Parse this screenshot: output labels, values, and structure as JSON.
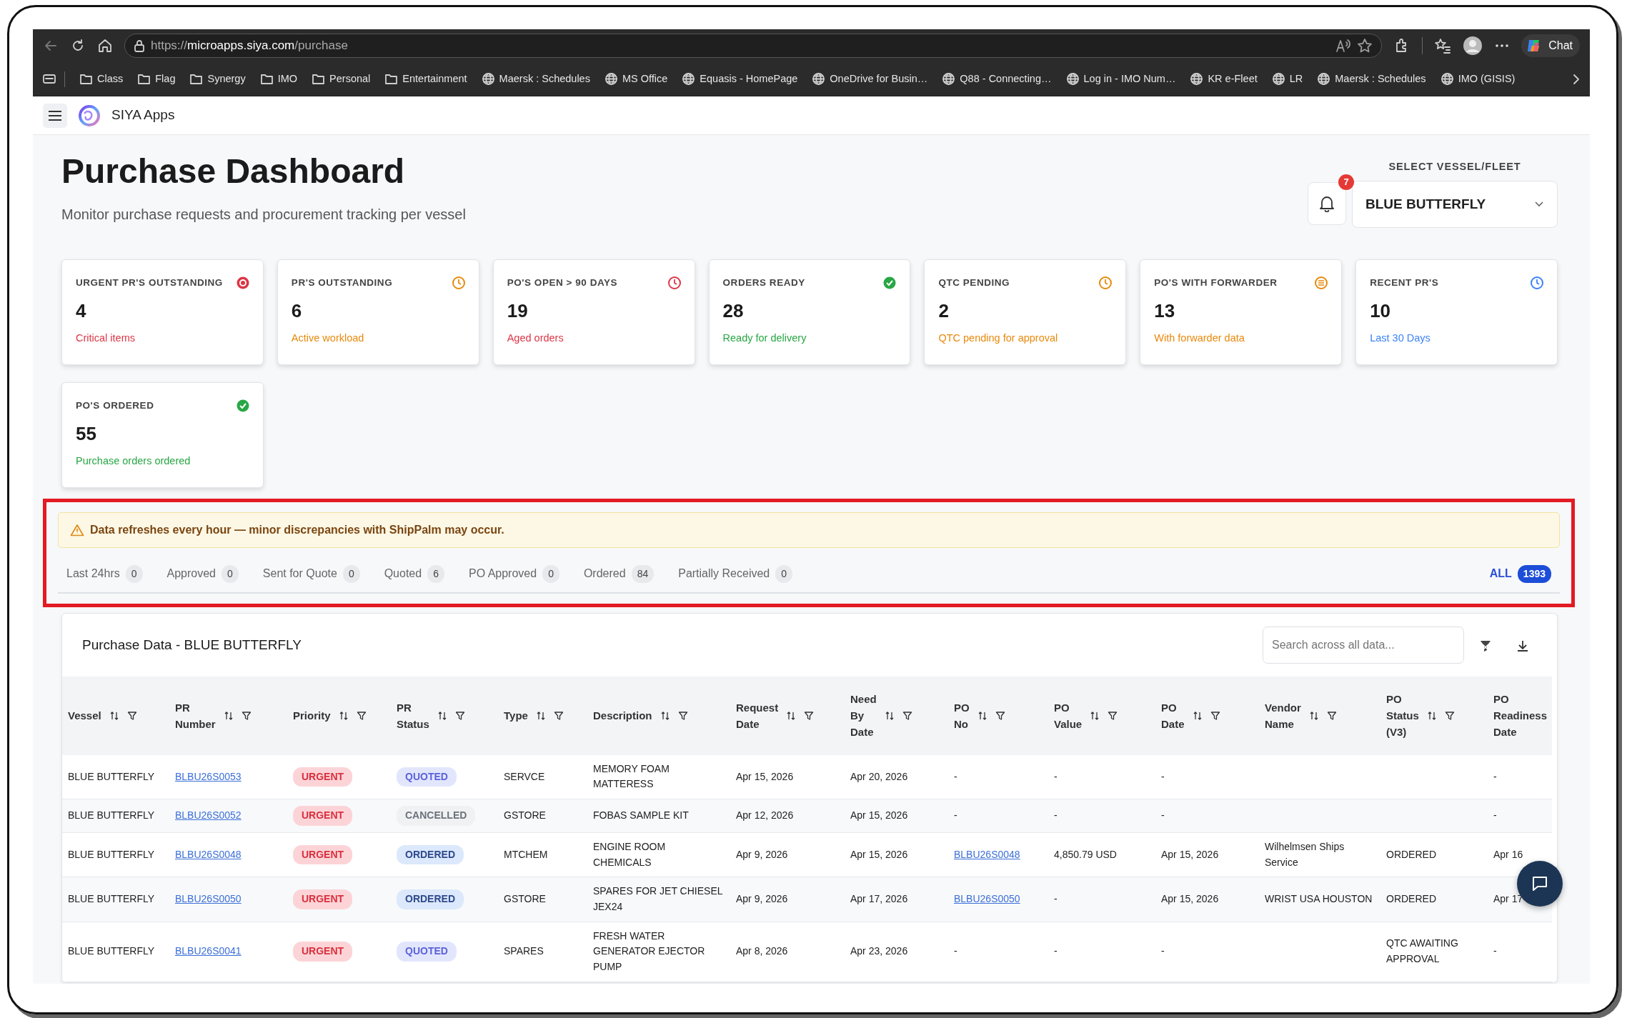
{
  "browser": {
    "url": {
      "scheme": "https://",
      "host": "microapps.siya.com",
      "path": "/purchase"
    },
    "chat_label": "Chat",
    "bookmarks": [
      {
        "label": "Class",
        "kind": "folder"
      },
      {
        "label": "Flag",
        "kind": "folder"
      },
      {
        "label": "Synergy",
        "kind": "folder"
      },
      {
        "label": "IMO",
        "kind": "folder"
      },
      {
        "label": "Personal",
        "kind": "folder"
      },
      {
        "label": "Entertainment",
        "kind": "folder"
      },
      {
        "label": "Maersk : Schedules",
        "kind": "globe"
      },
      {
        "label": "MS Office",
        "kind": "globe"
      },
      {
        "label": "Equasis - HomePage",
        "kind": "globe"
      },
      {
        "label": "OneDrive for Busin…",
        "kind": "globe"
      },
      {
        "label": "Q88 - Connecting…",
        "kind": "globe"
      },
      {
        "label": "Log in - IMO Num…",
        "kind": "globe"
      },
      {
        "label": "KR e-Fleet",
        "kind": "globe"
      },
      {
        "label": "LR",
        "kind": "globe"
      },
      {
        "label": "Maersk : Schedules",
        "kind": "globe"
      },
      {
        "label": "IMO (GISIS)",
        "kind": "globe"
      }
    ]
  },
  "app": {
    "brand": "SIYA Apps"
  },
  "header": {
    "title": "Purchase Dashboard",
    "subtitle": "Monitor purchase requests and procurement tracking per vessel",
    "notification_count": "7",
    "vessel_select": {
      "label": "SELECT VESSEL/FLEET",
      "value": "BLUE BUTTERFLY"
    }
  },
  "kpis": [
    {
      "title": "URGENT PR'S OUTSTANDING",
      "value": "4",
      "note": "Critical items",
      "kind": "alert",
      "color": "#dc3545"
    },
    {
      "title": "PR'S OUTSTANDING",
      "value": "6",
      "note": "Active workload",
      "kind": "clock",
      "color": "#e8890c"
    },
    {
      "title": "PO'S OPEN > 90 DAYS",
      "value": "19",
      "note": "Aged orders",
      "kind": "clock",
      "color": "#dc3545"
    },
    {
      "title": "ORDERS READY",
      "value": "28",
      "note": "Ready for delivery",
      "kind": "check",
      "color": "#28a745"
    },
    {
      "title": "QTC PENDING",
      "value": "2",
      "note": "QTC pending for approval",
      "kind": "clock",
      "color": "#e8890c"
    },
    {
      "title": "PO'S WITH FORWARDER",
      "value": "13",
      "note": "With forwarder data",
      "kind": "list",
      "color": "#e8890c"
    },
    {
      "title": "RECENT PR'S",
      "value": "10",
      "note": "Last 30 Days",
      "kind": "clock",
      "color": "#3b82f6"
    },
    {
      "title": "PO'S ORDERED",
      "value": "55",
      "note": "Purchase orders ordered",
      "kind": "check",
      "color": "#28a745"
    }
  ],
  "notice": "Data refreshes every hour — minor discrepancies with ShipPalm may occur.",
  "filters": [
    {
      "label": "Last 24hrs",
      "count": "0",
      "selected": false
    },
    {
      "label": "Approved",
      "count": "0",
      "selected": false
    },
    {
      "label": "Sent for Quote",
      "count": "0",
      "selected": false
    },
    {
      "label": "Quoted",
      "count": "6",
      "selected": false
    },
    {
      "label": "PO Approved",
      "count": "0",
      "selected": false
    },
    {
      "label": "Ordered",
      "count": "84",
      "selected": false
    },
    {
      "label": "Partially Received",
      "count": "0",
      "selected": false
    }
  ],
  "all_filter": {
    "label": "ALL",
    "count": "1393",
    "selected": true
  },
  "table": {
    "title": "Purchase Data - BLUE BUTTERFLY",
    "search": {
      "placeholder": "Search across all data..."
    },
    "columns": [
      {
        "label": "Vessel"
      },
      {
        "label": "PR Number"
      },
      {
        "label": "Priority"
      },
      {
        "label": "PR Status"
      },
      {
        "label": "Type"
      },
      {
        "label": "Description"
      },
      {
        "label": "Request Date"
      },
      {
        "label": "Need By Date"
      },
      {
        "label": "PO No"
      },
      {
        "label": "PO Value"
      },
      {
        "label": "PO Date"
      },
      {
        "label": "Vendor Name"
      },
      {
        "label": "PO Status (V3)"
      },
      {
        "label": "PO Readiness Date"
      }
    ],
    "rows": [
      {
        "vessel": "BLUE BUTTERFLY",
        "pr_number": "BLBU26S0053",
        "priority": {
          "text": "URGENT",
          "kind": "urgent"
        },
        "pr_status": {
          "text": "QUOTED",
          "kind": "quoted"
        },
        "type": "SERVCE",
        "description": "MEMORY FOAM MATTERESS",
        "request_date": "Apr 15, 2026",
        "need_by_date": "Apr 20, 2026",
        "po_no": "-",
        "po_no_link": false,
        "po_value": "-",
        "po_date": "-",
        "po_readiness_date": "-"
      },
      {
        "vessel": "BLUE BUTTERFLY",
        "pr_number": "BLBU26S0052",
        "priority": {
          "text": "URGENT",
          "kind": "urgent"
        },
        "pr_status": {
          "text": "CANCELLED",
          "kind": "cancelled"
        },
        "type": "GSTORE",
        "description": "FOBAS SAMPLE KIT",
        "request_date": "Apr 12, 2026",
        "need_by_date": "Apr 15, 2026",
        "po_no": "-",
        "po_no_link": false,
        "po_value": "-",
        "po_date": "-",
        "po_readiness_date": "-"
      },
      {
        "vessel": "BLUE BUTTERFLY",
        "pr_number": "BLBU26S0048",
        "priority": {
          "text": "URGENT",
          "kind": "urgent"
        },
        "pr_status": {
          "text": "ORDERED",
          "kind": "ordered"
        },
        "type": "MTCHEM",
        "description": "ENGINE ROOM CHEMICALS",
        "request_date": "Apr 9, 2026",
        "need_by_date": "Apr 15, 2026",
        "po_no": "BLBU26S0048",
        "po_no_link": true,
        "po_value": "4,850.79 USD",
        "po_date": "Apr 15, 2026",
        "vendor_name": "Wilhelmsen Ships Service",
        "po_status": "ORDERED",
        "po_readiness_date": "Apr 16"
      },
      {
        "vessel": "BLUE BUTTERFLY",
        "pr_number": "BLBU26S0050",
        "priority": {
          "text": "URGENT",
          "kind": "urgent"
        },
        "pr_status": {
          "text": "ORDERED",
          "kind": "ordered"
        },
        "type": "GSTORE",
        "description": "SPARES FOR JET CHIESEL JEX24",
        "request_date": "Apr 9, 2026",
        "need_by_date": "Apr 17, 2026",
        "po_no": "BLBU26S0050",
        "po_no_link": true,
        "po_value": "-",
        "po_date": "Apr 15, 2026",
        "vendor_name": "WRIST USA HOUSTON",
        "po_status": "ORDERED",
        "po_readiness_date": "Apr 17"
      },
      {
        "vessel": "BLUE BUTTERFLY",
        "pr_number": "BLBU26S0041",
        "priority": {
          "text": "URGENT",
          "kind": "urgent"
        },
        "pr_status": {
          "text": "QUOTED",
          "kind": "quoted"
        },
        "type": "SPARES",
        "description": "FRESH WATER GENERATOR EJECTOR PUMP",
        "request_date": "Apr 8, 2026",
        "need_by_date": "Apr 23, 2026",
        "po_no": "-",
        "po_no_link": false,
        "po_value": "-",
        "po_date": "-",
        "po_status": "QTC AWAITING APPROVAL",
        "po_readiness_date": "-"
      }
    ]
  }
}
